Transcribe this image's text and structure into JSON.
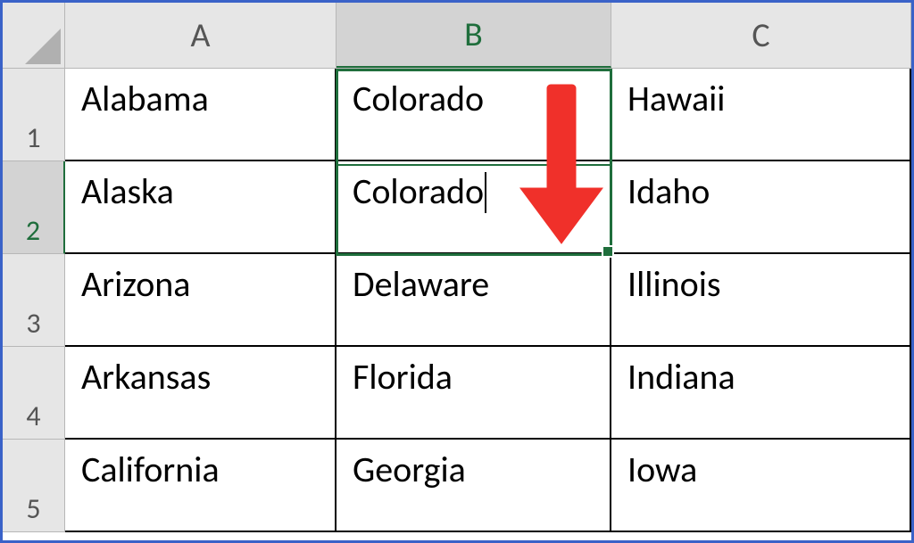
{
  "columns": [
    "A",
    "B",
    "C"
  ],
  "rows": [
    "1",
    "2",
    "3",
    "4",
    "5"
  ],
  "cells": {
    "r1": {
      "A": "Alabama",
      "B": "Colorado",
      "C": "Hawaii"
    },
    "r2": {
      "A": "Alaska",
      "B": "Colorado",
      "C": "Idaho"
    },
    "r3": {
      "A": "Arizona",
      "B": "Delaware",
      "C": "Illinois"
    },
    "r4": {
      "A": "Arkansas",
      "B": "Florida",
      "C": "Indiana"
    },
    "r5": {
      "A": "California",
      "B": "Georgia",
      "C": "Iowa"
    }
  },
  "selection": {
    "range": "B1:B2",
    "editing_cell": "B2"
  },
  "annotation": {
    "type": "arrow-down",
    "color": "#f0302a"
  }
}
